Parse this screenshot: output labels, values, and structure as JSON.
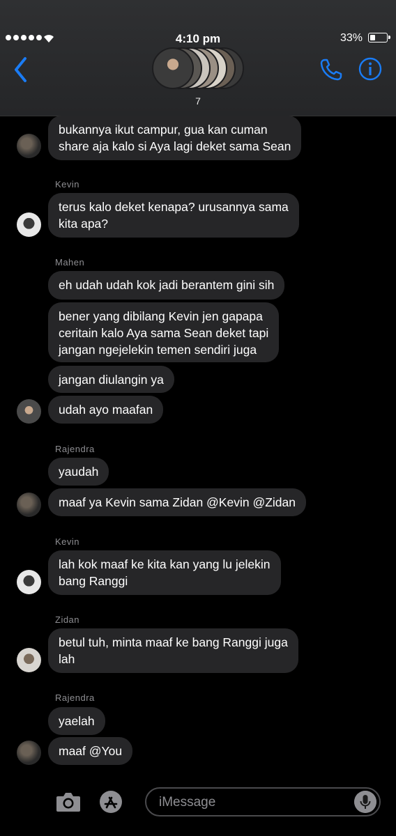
{
  "status_bar": {
    "time": "4:10 pm",
    "battery_percent": "33%",
    "battery_level": 0.33,
    "signal_bars": 5
  },
  "header": {
    "member_count": "7"
  },
  "colors": {
    "accent": "#1a7cf5",
    "bubble": "#262628",
    "background": "#000000",
    "sender_text": "#8e8e92"
  },
  "messages": [
    {
      "text": "bukannya ikut campur, gua kan cuman\nshare aja kalo si Aya lagi deket sama Sean"
    },
    {
      "sender": "Kevin",
      "text": "terus kalo deket kenapa? urusannya sama\nkita apa?"
    },
    {
      "sender": "Mahen",
      "text": "eh udah udah kok jadi berantem gini sih"
    },
    {
      "text": "bener yang dibilang Kevin jen gapapa\nceritain kalo Aya sama Sean deket tapi\njangan ngejelekin temen sendiri juga"
    },
    {
      "text": "jangan diulangin ya"
    },
    {
      "text": "udah ayo maafan"
    },
    {
      "sender": "Rajendra",
      "text": "yaudah"
    },
    {
      "text": "maaf ya Kevin sama Zidan @Kevin @Zidan"
    },
    {
      "sender": "Kevin",
      "text": "lah kok maaf ke kita kan yang lu jelekin\nbang Ranggi"
    },
    {
      "sender": "Zidan",
      "text": "betul tuh, minta maaf ke bang Ranggi juga\nlah"
    },
    {
      "sender": "Rajendra",
      "text": "yaelah"
    },
    {
      "text": "maaf @You"
    }
  ],
  "composer": {
    "placeholder": "iMessage"
  }
}
